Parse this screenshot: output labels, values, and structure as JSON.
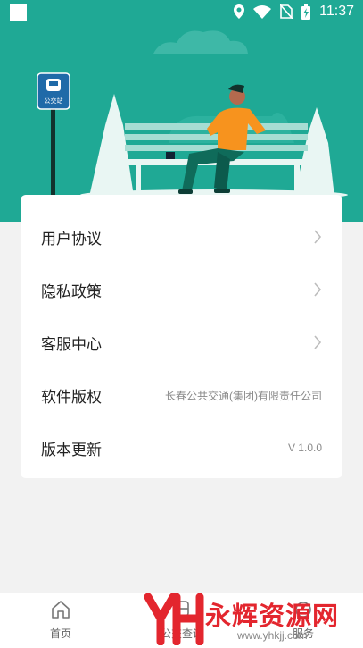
{
  "status_bar": {
    "time": "11:37",
    "icons": [
      "location-icon",
      "wifi-icon",
      "no-sim-icon",
      "battery-charging-icon"
    ]
  },
  "hero": {
    "bus_stop_sign": "公交站",
    "colors": {
      "background": "#1fa995",
      "shirt": "#f7931e",
      "pants": "#0f6b5a"
    }
  },
  "menu": {
    "items": [
      {
        "label": "用户协议",
        "chevron": true
      },
      {
        "label": "隐私政策",
        "chevron": true
      },
      {
        "label": "客服中心",
        "chevron": true
      },
      {
        "label": "软件版权",
        "value": "长春公共交通(集团)有限责任公司"
      },
      {
        "label": "版本更新",
        "value": "V 1.0.0"
      }
    ]
  },
  "tabbar": {
    "tabs": [
      {
        "label": "首页",
        "icon": "home-icon"
      },
      {
        "label": "公交查询",
        "icon": "bus-query-icon"
      },
      {
        "label": "服务",
        "icon": "service-icon"
      }
    ]
  },
  "watermark": {
    "text": "永辉资源网",
    "url": "www.yhkjj.com"
  }
}
